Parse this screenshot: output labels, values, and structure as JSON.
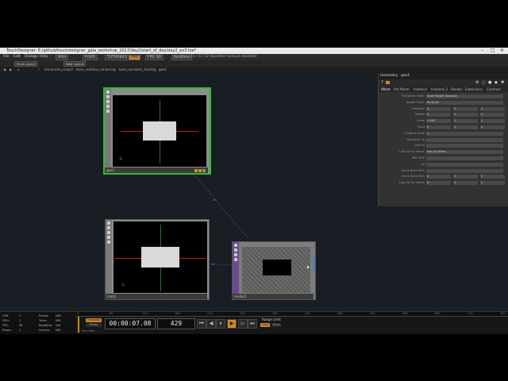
{
  "window": {
    "title": "TouchDesigner: E:/github/touchdesigner_gala_workshop_2017/day2/start_of_day/day2_ex3.toe*",
    "minimize": "–",
    "maximize": "□",
    "close": "✕"
  },
  "menu": {
    "items": [
      "File",
      "Edit",
      "Dialogs",
      "Help"
    ],
    "buttons": [
      "#SH",
      "P-SYS",
      "TUTORIALS",
      "PRO",
      "FPS: 60",
      "Realtime"
    ],
    "status": "23 / 4 / 32 Operator lockups disabled"
  },
  "toolbar": {
    "pane_layout": "Pane Layout",
    "new_layout": "New Layout"
  },
  "path": {
    "crumbs": [
      "/",
      "immersed_project",
      "base_realtime_rendering",
      "base_constant_shading",
      "geo1"
    ]
  },
  "network": {
    "nodes": [
      {
        "name": "geo1",
        "glyph": "· ·"
      },
      {
        "name": "cam1",
        "glyph": "· ·"
      },
      {
        "name": "render1"
      }
    ]
  },
  "params": {
    "op_type": "Geometry",
    "op_name": "geo1",
    "tabs": [
      "Xform",
      "Pre-Xform",
      "Instance",
      "Instance 2",
      "Render",
      "Extensions",
      "Common"
    ],
    "rows": [
      {
        "label": "Transform Order",
        "values": [
          "Scale Rotate Translate"
        ]
      },
      {
        "label": "Rotate Order",
        "values": [
          "Rx Ry Rz"
        ]
      },
      {
        "label": "Translate",
        "values": [
          "0",
          "0",
          "0"
        ]
      },
      {
        "label": "Rotate",
        "values": [
          "0",
          "0",
          "0"
        ]
      },
      {
        "label": "Scale",
        "values": [
          "1.296",
          "1",
          "1"
        ]
      },
      {
        "label": "Pivot",
        "values": [
          "0",
          "0",
          "0"
        ]
      },
      {
        "label": "Uniform Scale",
        "values": [
          "1"
        ]
      },
      {
        "label": "Transform To",
        "values": [
          ""
        ]
      },
      {
        "label": "Look At",
        "values": [
          ""
        ]
      },
      {
        "label": "Look At Up Vector",
        "values": [
          "Use Up Vector"
        ]
      },
      {
        "label": "Path SOP",
        "values": [
          ""
        ]
      },
      {
        "label": "Up",
        "values": [
          ""
        ]
      },
      {
        "label": "Force Bank Path",
        "values": [
          ""
        ]
      },
      {
        "label": "Force Bank Path",
        "values": [
          "0",
          "0",
          "0"
        ]
      },
      {
        "label": "Look At Up Vector",
        "values": [
          "0",
          "0",
          "0"
        ]
      }
    ]
  },
  "perf": {
    "lines": [
      "CPU:",
      "GPU:",
      "FPS:",
      "Drops:",
      "Frame:",
      "Time:",
      "Realtime:",
      "Frames:"
    ],
    "vals": [
      "1",
      "1",
      "48",
      "1",
      "NSC",
      "NSC",
      "N/A",
      "N/A"
    ]
  },
  "timeline": {
    "ruler_ticks": [
      "0",
      "60",
      "120",
      "180",
      "240",
      "300",
      "360",
      "420",
      "480",
      "540",
      "600",
      "660",
      "720",
      "780"
    ],
    "timecode_label": "Timecode",
    "beats_label": "Beats",
    "timecode": "00:00:07.08",
    "frame": "429",
    "range_label": "Range Limit",
    "loop": "Loop",
    "once": "Once",
    "time_path": "Time Path"
  },
  "colors": {
    "accent": "#c98a2a",
    "selected": "#25c425",
    "render_node": "#6a4a90"
  }
}
